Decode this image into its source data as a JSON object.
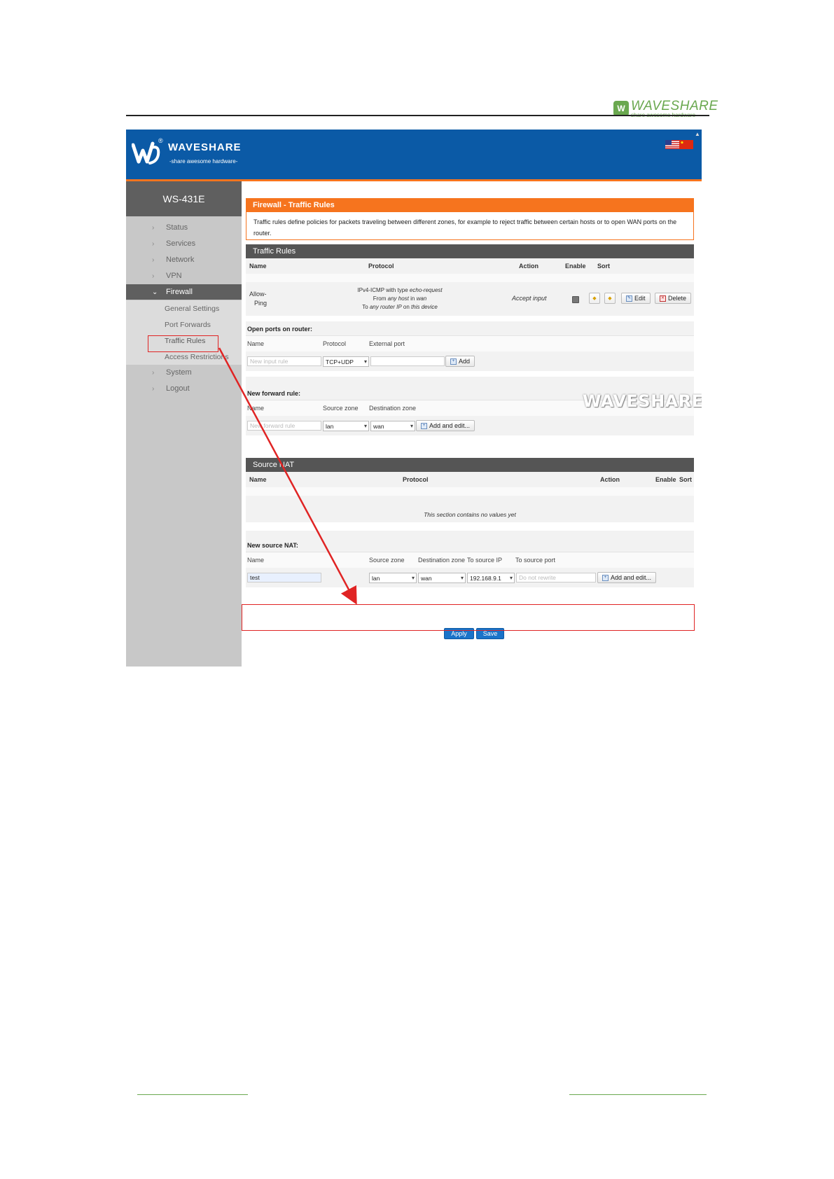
{
  "doc_header": {
    "brand": "WAVESHARE",
    "tagline": "share awesome hardware",
    "logo_mark": "W"
  },
  "router_ui": {
    "brand": "WAVESHARE",
    "tagline": "-share awesome hardware-",
    "registered": "®",
    "device_name": "WS-431E",
    "watermark": "WAVESHARE",
    "colors": {
      "topbar": "#0b5aa6",
      "accent": "#f6741e",
      "sidebar": "#c8c8c8",
      "sidebar_dark": "#5f5f5f",
      "highlight": "#e02424"
    },
    "nav": [
      {
        "label": "Status"
      },
      {
        "label": "Services"
      },
      {
        "label": "Network"
      },
      {
        "label": "VPN"
      },
      {
        "label": "Firewall"
      },
      {
        "label": "System"
      },
      {
        "label": "Logout"
      }
    ],
    "firewall_sub": [
      {
        "label": "General Settings"
      },
      {
        "label": "Port Forwards"
      },
      {
        "label": "Traffic Rules"
      },
      {
        "label": "Access Restrictions"
      }
    ],
    "page": {
      "title": "Firewall - Traffic Rules",
      "description": "Traffic rules define policies for packets traveling between different zones, for example to reject traffic between certain hosts or to open WAN ports on the router."
    },
    "traffic_rules": {
      "title": "Traffic Rules",
      "headers": {
        "name": "Name",
        "protocol": "Protocol",
        "action": "Action",
        "enable": "Enable",
        "sort": "Sort"
      },
      "row": {
        "name_line1": "Allow-",
        "name_line2": "Ping",
        "proto_line1_a": "IPv4-ICMP with type ",
        "proto_line1_b": "echo-request",
        "proto_line2_a": "From ",
        "proto_line2_b": "any host",
        "proto_line2_c": " in ",
        "proto_line2_d": "wan",
        "proto_line3_a": "To ",
        "proto_line3_b": "any router IP",
        "proto_line3_c": " on ",
        "proto_line3_d": "this device",
        "action": "Accept input",
        "edit": "Edit",
        "delete": "Delete"
      }
    },
    "open_ports": {
      "title": "Open ports on router:",
      "headers": {
        "name": "Name",
        "protocol": "Protocol",
        "external_port": "External port"
      },
      "name_placeholder": "New input rule",
      "protocol_value": "TCP+UDP",
      "add": "Add"
    },
    "forward_rules": {
      "title": "New forward rule:",
      "headers": {
        "name": "Name",
        "source_zone": "Source zone",
        "dest_zone": "Destination zone"
      },
      "name_placeholder": "New forward rule",
      "source_value": "lan",
      "dest_value": "wan",
      "add_edit": "Add and edit..."
    },
    "source_nat": {
      "title": "Source NAT",
      "headers": {
        "name": "Name",
        "protocol": "Protocol",
        "action": "Action",
        "enable": "Enable",
        "sort": "Sort"
      },
      "empty": "This section contains no values yet"
    },
    "new_source_nat": {
      "title": "New source NAT:",
      "headers": {
        "name": "Name",
        "source_zone": "Source zone",
        "dest_zone": "Destination zone",
        "to_source_ip": "To source IP",
        "to_source_port": "To source port"
      },
      "name_value": "test",
      "source_value": "lan",
      "dest_value": "wan",
      "ip_value": "192.168.9.1",
      "port_placeholder": "Do not rewrite",
      "add_edit": "Add and edit..."
    },
    "actions": {
      "apply": "Apply",
      "save": "Save"
    }
  }
}
